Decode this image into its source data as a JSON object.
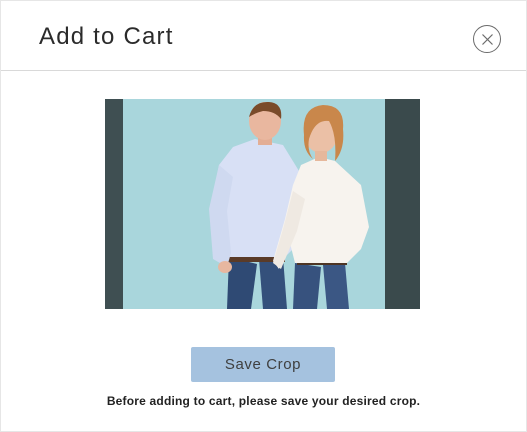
{
  "modal": {
    "title": "Add to Cart",
    "close_icon": "close-icon"
  },
  "crop": {
    "image_description_icon": "photo"
  },
  "actions": {
    "save_crop_label": "Save Crop"
  },
  "footer": {
    "note": "Before adding to cart, please save your desired crop."
  },
  "colors": {
    "button_bg": "#a5c2df",
    "crop_mask": "#3f4f52",
    "photo_bg": "#a9d6dc"
  }
}
